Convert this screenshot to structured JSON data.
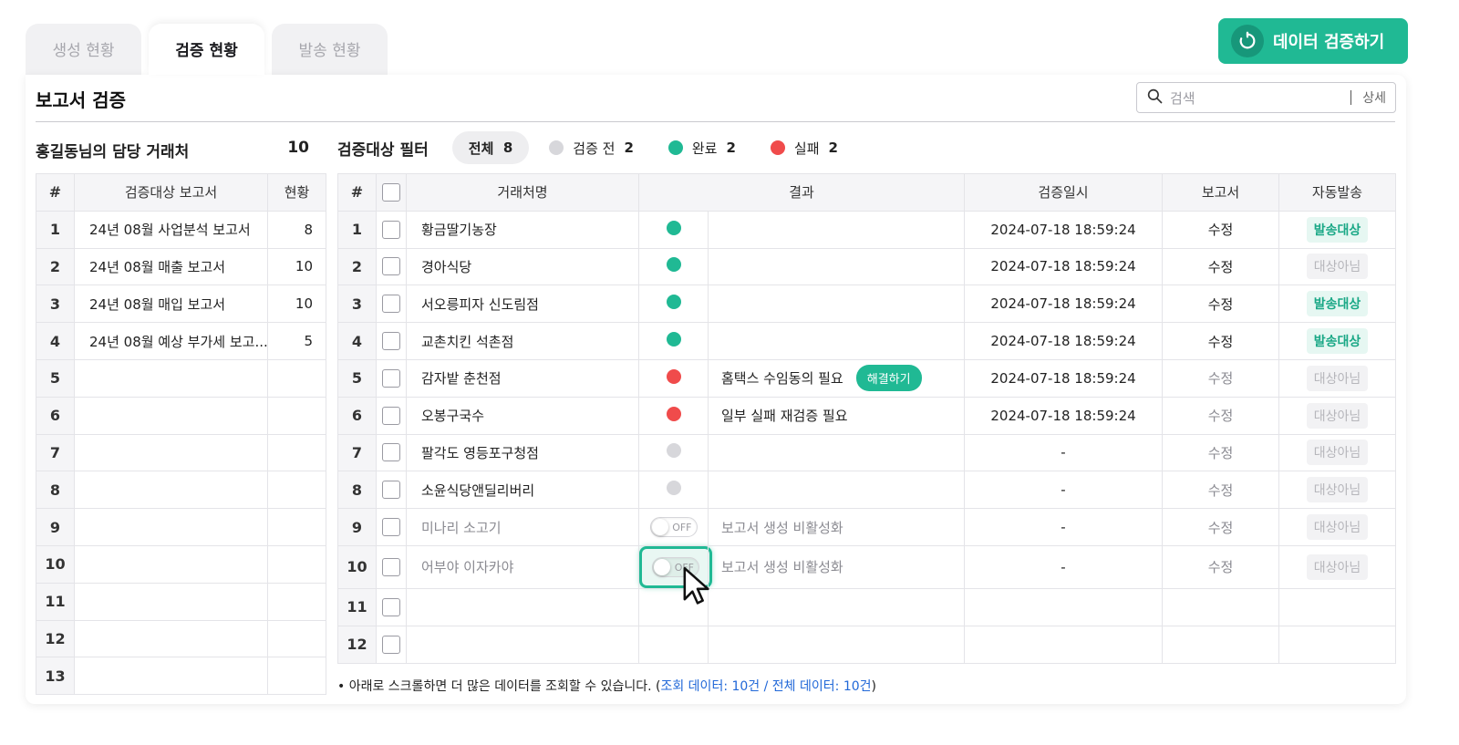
{
  "tabs": [
    "생성 현황",
    "검증 현황",
    "발송 현황"
  ],
  "verify_button": "데이터 검증하기",
  "card_title": "보고서 검증",
  "search": {
    "placeholder": "검색",
    "detail": "상세"
  },
  "left_panel": {
    "title": "홍길동님의 담당 거래처",
    "count": "10",
    "headers": [
      "#",
      "검증대상 보고서",
      "현황"
    ],
    "rows": [
      {
        "n": "1",
        "name": "24년 08월 사업분석 보고서",
        "cnt": "8"
      },
      {
        "n": "2",
        "name": "24년 08월 매출 보고서",
        "cnt": "10"
      },
      {
        "n": "3",
        "name": "24년 08월 매입 보고서",
        "cnt": "10"
      },
      {
        "n": "4",
        "name": "24년 08월 예상 부가세 보고...",
        "cnt": "5"
      },
      {
        "n": "5",
        "name": "",
        "cnt": ""
      },
      {
        "n": "6",
        "name": "",
        "cnt": ""
      },
      {
        "n": "7",
        "name": "",
        "cnt": ""
      },
      {
        "n": "8",
        "name": "",
        "cnt": ""
      },
      {
        "n": "9",
        "name": "",
        "cnt": ""
      },
      {
        "n": "10",
        "name": "",
        "cnt": ""
      },
      {
        "n": "11",
        "name": "",
        "cnt": ""
      },
      {
        "n": "12",
        "name": "",
        "cnt": ""
      },
      {
        "n": "13",
        "name": "",
        "cnt": ""
      }
    ]
  },
  "filter": {
    "label": "검증대상 필터",
    "all": "전체",
    "all_count": "8",
    "pending": "검증 전",
    "pending_count": "2",
    "done": "완료",
    "done_count": "2",
    "fail": "실패",
    "fail_count": "2"
  },
  "right_table": {
    "headers": [
      "#",
      "거래처명",
      "결과",
      "검증일시",
      "보고서",
      "자동발송"
    ],
    "rows": [
      {
        "n": "1",
        "name": "황금딸기농장",
        "status": "green",
        "result": "",
        "date": "2024-07-18  18:59:24",
        "report": "수정",
        "auto": "발송대상",
        "auto_on": true
      },
      {
        "n": "2",
        "name": "경아식당",
        "status": "green",
        "result": "",
        "date": "2024-07-18  18:59:24",
        "report": "수정",
        "auto": "대상아님",
        "auto_on": false
      },
      {
        "n": "3",
        "name": "서오릉피자 신도림점",
        "status": "green",
        "result": "",
        "date": "2024-07-18  18:59:24",
        "report": "수정",
        "auto": "발송대상",
        "auto_on": true
      },
      {
        "n": "4",
        "name": "교촌치킨 석촌점",
        "status": "green",
        "result": "",
        "date": "2024-07-18  18:59:24",
        "report": "수정",
        "auto": "발송대상",
        "auto_on": true
      },
      {
        "n": "5",
        "name": "감자밭 춘천점",
        "status": "red",
        "result": "홈택스 수임동의 필요",
        "resolve": "해결하기",
        "date": "2024-07-18  18:59:24",
        "report": "수정",
        "report_muted": true,
        "auto": "대상아님",
        "auto_on": false
      },
      {
        "n": "6",
        "name": "오봉구국수",
        "status": "red",
        "result": "일부 실패 재검증 필요",
        "date": "2024-07-18  18:59:24",
        "report": "수정",
        "report_muted": true,
        "auto": "대상아님",
        "auto_on": false
      },
      {
        "n": "7",
        "name": "팔각도 영등포구청점",
        "status": "gray",
        "result": "",
        "date": "-",
        "report": "수정",
        "report_muted": true,
        "auto": "대상아님",
        "auto_on": false
      },
      {
        "n": "8",
        "name": "소윤식당앤딜리버리",
        "status": "gray",
        "result": "",
        "date": "-",
        "report": "수정",
        "report_muted": true,
        "auto": "대상아님",
        "auto_on": false
      },
      {
        "n": "9",
        "name": "미나리 소고기",
        "status": "toggle",
        "toggle": "OFF",
        "result": "보고서 생성 비활성화",
        "muted": true,
        "date": "-",
        "report": "수정",
        "report_muted": true,
        "auto": "대상아님",
        "auto_on": false
      },
      {
        "n": "10",
        "name": "어부야 이자카야",
        "status": "toggle-hl",
        "toggle": "OFF",
        "result": "보고서 생성 비활성화",
        "muted": true,
        "date": "-",
        "report": "수정",
        "report_muted": true,
        "auto": "대상아님",
        "auto_on": false
      },
      {
        "n": "11",
        "empty": true
      },
      {
        "n": "12",
        "empty": true
      }
    ]
  },
  "note": {
    "text": "• 아래로 스크롤하면 더 많은 데이터를 조회할 수 있습니다. (",
    "link": "조회 데이터: 10건 / 전체 데이터: 10건",
    "close": ")"
  },
  "colors": {
    "accent": "#20b994",
    "fail": "#f04b4b",
    "pending": "#d7d7db",
    "link": "#2168d8"
  }
}
